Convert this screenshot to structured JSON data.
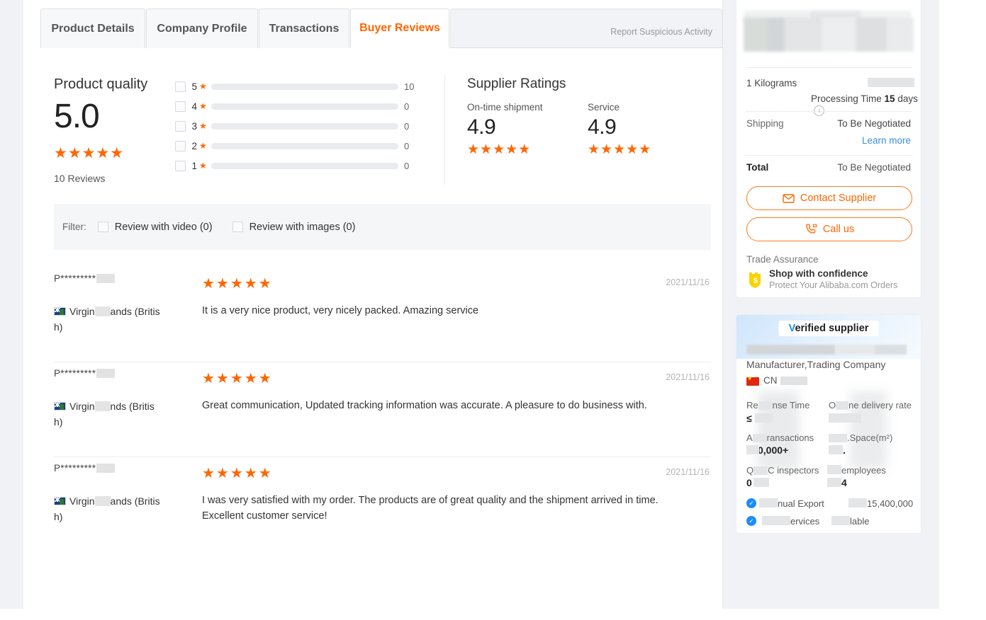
{
  "tabs": [
    {
      "label": "Product Details",
      "active": false
    },
    {
      "label": "Company Profile",
      "active": false
    },
    {
      "label": "Transactions",
      "active": false
    },
    {
      "label": "Buyer Reviews",
      "active": true
    }
  ],
  "report_link": "Report Suspicious Activity",
  "product_quality": {
    "title": "Product quality",
    "score": "5.0",
    "stars": "★★★★★",
    "review_count_label": "10 Reviews"
  },
  "rating_breakdown": [
    {
      "stars": "5",
      "star_glyph": "★",
      "count": "10",
      "percent": 100
    },
    {
      "stars": "4",
      "star_glyph": "★",
      "count": "0",
      "percent": 0
    },
    {
      "stars": "3",
      "star_glyph": "★",
      "count": "0",
      "percent": 0
    },
    {
      "stars": "2",
      "star_glyph": "★",
      "count": "0",
      "percent": 0
    },
    {
      "stars": "1",
      "star_glyph": "★",
      "count": "0",
      "percent": 0
    }
  ],
  "supplier_ratings": {
    "title": "Supplier Ratings",
    "items": [
      {
        "label": "On-time shipment",
        "score": "4.9",
        "stars": "★★★★★"
      },
      {
        "label": "Service",
        "score": "4.9",
        "stars": "★★★★★"
      }
    ]
  },
  "filter": {
    "label": "Filter:",
    "options": [
      {
        "label": "Review with video (0)",
        "checked": false
      },
      {
        "label": "Review with images (0)",
        "checked": false
      }
    ]
  },
  "reviews": [
    {
      "user": "P*********",
      "country": "Virgin",
      "country_rest": "ands (Britis",
      "country_line2": "h)",
      "stars": "★★★★★",
      "date": "2021/11/16",
      "text": "It is a very nice product, very nicely packed. Amazing service"
    },
    {
      "user": "P*********",
      "country": "Virgin",
      "country_rest": "nds (Britis",
      "country_line2": "h)",
      "stars": "★★★★★",
      "date": "2021/11/16",
      "text": "Great communication, Updated tracking information was accurate. A pleasure to do business with."
    },
    {
      "user": "P*********",
      "country": "Virgin",
      "country_rest": "ands (Britis",
      "country_line2": "h)",
      "stars": "★★★★★",
      "date": "2021/11/16",
      "text": "I was very satisfied with my order. The products are of great quality and the shipment arrived in time. Excellent customer service!"
    }
  ],
  "order_panel": {
    "weight": "1 Kilograms",
    "processing_time_prefix": "Processing Time ",
    "processing_time_value": "15",
    "processing_time_suffix": " days",
    "shipping_label": "Shipping",
    "shipping_value": "To Be Negotiated",
    "learn_more": "Learn more",
    "total_label": "Total",
    "total_value": "To Be Negotiated",
    "contact_button": "Contact Supplier",
    "call_button": "Call us",
    "trade_assurance_label": "Trade Assurance",
    "trade_assurance_title": "Shop with confidence",
    "trade_assurance_sub": "Protect Your Alibaba.com Orders"
  },
  "supplier_card": {
    "badge_v": "V",
    "badge_rest": "erified supplier",
    "company_type": "Manufacturer,Trading Company",
    "country_code": "CN",
    "stats": [
      {
        "label": "Response Time",
        "label_visible": "nse Time",
        "label_prefix": "Re",
        "value": "≤"
      },
      {
        "label": "On-time delivery rate",
        "label_visible": "ne delivery rate",
        "label_prefix": "O",
        "value": ""
      },
      {
        "label": "Transactions",
        "label_visible": "ransactions",
        "label_prefix": "A",
        "value": "0,000+"
      },
      {
        "label": "Floor Space(m²)",
        "label_visible": ".Space(m²)",
        "label_prefix": "",
        "value": "."
      },
      {
        "label": "QA/QC inspectors",
        "label_visible": "C inspectors",
        "label_prefix": "Q",
        "value": "0"
      },
      {
        "label": "employees",
        "label_visible": "employees",
        "label_prefix": "",
        "value": "4"
      }
    ],
    "verified_lines": [
      {
        "text_a": "nual Export",
        "text_b": "15,400,000"
      },
      {
        "text_a": "ervices",
        "text_b": "lable"
      }
    ]
  },
  "colors": {
    "accent_orange": "#ff6600",
    "link_blue": "#3a8fd8",
    "verified_blue": "#1a8cff",
    "page_bg": "#f0f2f5",
    "shield_yellow": "#fbd200"
  }
}
